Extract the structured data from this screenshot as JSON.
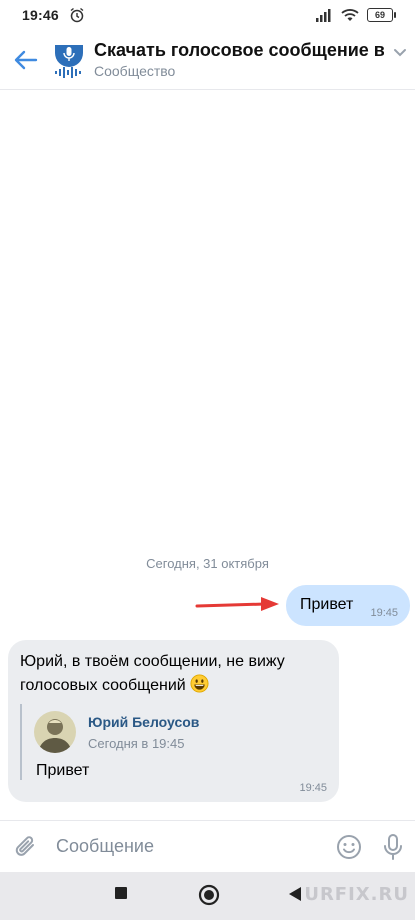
{
  "status_bar": {
    "time": "19:46",
    "battery": "69"
  },
  "header": {
    "title": "Скачать голосовое сообщение в...",
    "subtitle": "Сообщество"
  },
  "chat": {
    "date_separator": "Сегодня, 31 октября",
    "outgoing": {
      "text": "Привет",
      "time": "19:45"
    },
    "incoming": {
      "text": "Юрий, в твоём сообщении, не вижу голосовых сообщений",
      "time": "19:45",
      "forwarded": {
        "author": "Юрий Белоусов",
        "date": "Сегодня в 19:45",
        "text": "Привет"
      }
    }
  },
  "composer": {
    "placeholder": "Сообщение"
  },
  "watermark": "URFIX.RU",
  "colors": {
    "accent": "#3f8ae0",
    "outgoing_bubble": "#cce4ff",
    "incoming_bubble": "#ebedf0",
    "link": "#2a5885",
    "arrow": "#e53935"
  }
}
